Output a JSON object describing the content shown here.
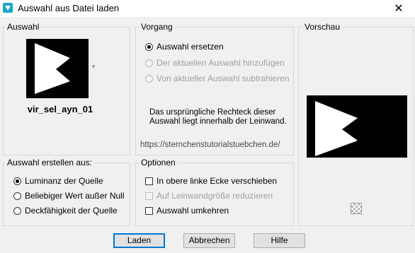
{
  "window": {
    "title": "Auswahl aus Datei laden",
    "close_glyph": "✕"
  },
  "auswahl": {
    "label": "Auswahl",
    "selection_name": "vir_sel_ayn_01"
  },
  "vorgang": {
    "label": "Vorgang",
    "options": [
      {
        "label": "Auswahl ersetzen",
        "checked": true,
        "disabled": false
      },
      {
        "label": "Der aktuellen Auswahl hinzufügen",
        "checked": false,
        "disabled": true
      },
      {
        "label": "Von aktueller Auswahl subtrahieren",
        "checked": false,
        "disabled": true
      }
    ],
    "info": "Das ursprüngliche Rechteck dieser Auswahl liegt innerhalb der Leinwand.",
    "watermark": "https://sternchenstutorialstuebchen.de/"
  },
  "vorschau": {
    "label": "Vorschau"
  },
  "erstellen": {
    "label": "Auswahl erstellen aus:",
    "options": [
      {
        "label": "Luminanz der Quelle",
        "checked": true
      },
      {
        "label": "Beliebiger Wert außer Null",
        "checked": false
      },
      {
        "label": "Deckfähigkeit der Quelle",
        "checked": false
      }
    ]
  },
  "optionen": {
    "label": "Optionen",
    "items": [
      {
        "label": "In obere linke Ecke verschieben",
        "checked": false,
        "disabled": false
      },
      {
        "label": "Auf Leinwandgröße reduzieren",
        "checked": false,
        "disabled": true
      },
      {
        "label": "Auswahl umkehren",
        "checked": false,
        "disabled": false
      }
    ]
  },
  "buttons": {
    "laden": "Laden",
    "abbrechen": "Abbrechen",
    "hilfe": "Hilfe"
  },
  "colors": {
    "accent": "#0078d7",
    "disabled_text": "#a0a0a0"
  }
}
